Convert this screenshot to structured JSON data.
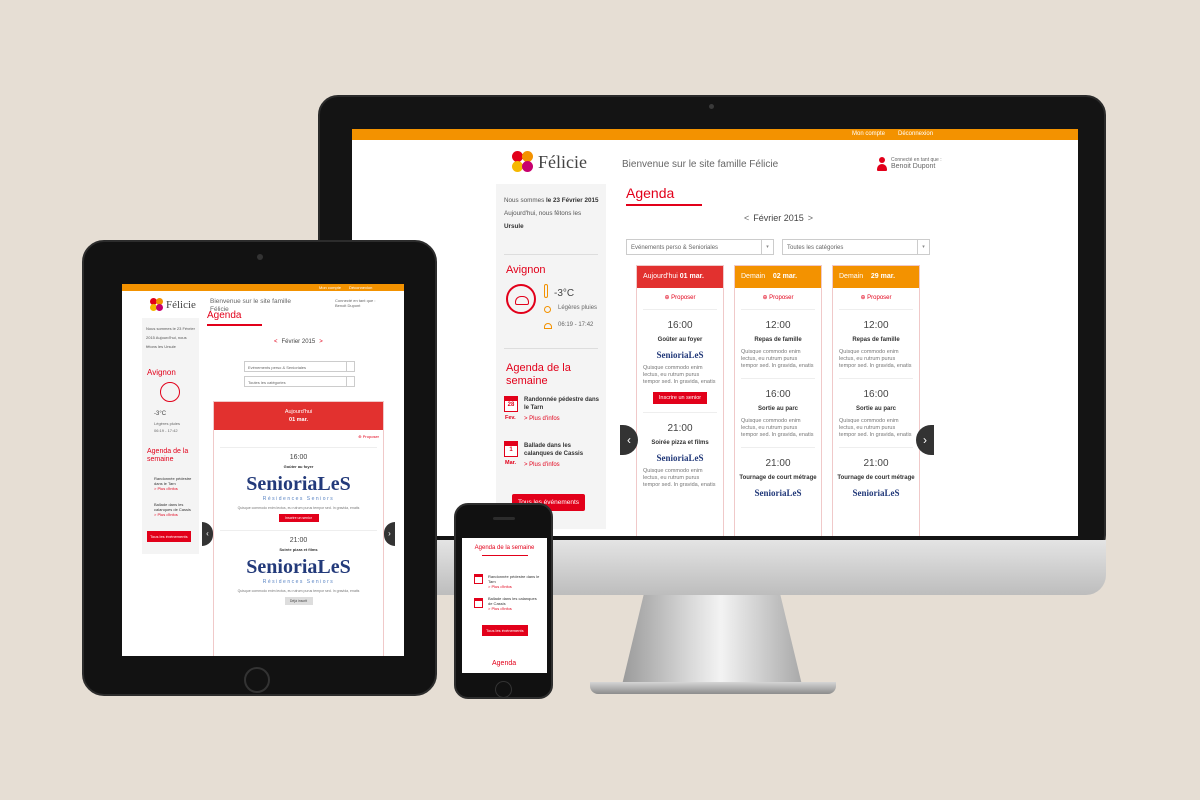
{
  "desktop": {
    "topbar": {
      "account": "Mon compte",
      "logout": "Déconnexion"
    },
    "logo": "Félicie",
    "welcome": "Bienvenue sur le site famille Félicie",
    "user": {
      "connected_as": "Connecté en tant que :",
      "name": "Benoit Dupont"
    },
    "sidebar": {
      "date_prefix": "Nous sommes",
      "date": "le 23 Février 2015",
      "feast_prefix": "Aujourd'hui, nous fêtons les",
      "feast_name": "Ursule",
      "city": "Avignon",
      "temperature": "-3°C",
      "weather": "Légères pluies",
      "sun_times": "06:19 - 17:42",
      "week_title": "Agenda de la semaine",
      "events": [
        {
          "day": "28",
          "month": "Fev.",
          "title": "Randonnée pédestre dans le Tarn",
          "link": "> Plus d'infos"
        },
        {
          "day": "1",
          "month": "Mar.",
          "title": "Ballade dans les calanques de Cassis",
          "link": "> Plus d'infos"
        }
      ],
      "all_events": "Tous les événements"
    },
    "agenda": {
      "title": "Agenda",
      "month": "Février 2015",
      "prev": "<",
      "next": ">",
      "filter1": "Evénements perso & Senioriales",
      "filter2": "Toutes les catégories",
      "propose": "Proposer",
      "columns": [
        {
          "head_a": "Aujourd'hui",
          "head_b": "01 mar.",
          "color": "#e2312f",
          "items": [
            {
              "time": "16:00",
              "title": "Goûter au foyer",
              "logo": "SenioriaLeS",
              "text": "Quisque commodo enim lectus, eu rutrum purus tempor sed. In gravida, enatis",
              "button": "Inscrire un senior"
            },
            {
              "time": "21:00",
              "title": "Soirée pizza et films",
              "logo": "SenioriaLeS",
              "text": "Quisque commodo enim lectus, eu rutrum purus tempor sed. In gravida, enatis"
            }
          ]
        },
        {
          "head_a": "Demain",
          "head_b": "02 mar.",
          "color": "#f39200",
          "items": [
            {
              "time": "12:00",
              "title": "Repas de famille",
              "text": "Quisque commodo enim lectus, eu rutrum purus tempor sed. In gravida, enatis"
            },
            {
              "time": "16:00",
              "title": "Sortie au parc",
              "text": "Quisque commodo enim lectus, eu rutrum purus tempor sed. In gravida, enatis"
            },
            {
              "time": "21:00",
              "title": "Tournage de court métrage",
              "logo": "SenioriaLeS"
            }
          ]
        },
        {
          "head_a": "Demain",
          "head_b": "29 mar.",
          "color": "#f39200",
          "items": [
            {
              "time": "12:00",
              "title": "Repas de famille",
              "text": "Quisque commodo enim lectus, eu rutrum purus tempor sed. In gravida, enatis"
            },
            {
              "time": "16:00",
              "title": "Sortie au parc",
              "text": "Quisque commodo enim lectus, eu rutrum purus tempor sed. In gravida, enatis"
            },
            {
              "time": "21:00",
              "title": "Tournage de court métrage",
              "logo": "SenioriaLeS"
            }
          ]
        }
      ]
    }
  },
  "tablet": {
    "topbar": {
      "account": "Mon compte",
      "logout": "Déconnexion"
    },
    "logo": "Félicie",
    "welcome": "Bienvenue sur le site famille Félicie",
    "user": "Connecté en tant que : Benoit Dupont",
    "date_text": "Nous sommes le 23 Février 2015 Aujourd'hui, nous fêtons les Ursule",
    "city": "Avignon",
    "temperature": "-3°C",
    "weather": "Légères pluies",
    "sun_times": "06:19 - 17:42",
    "week_title": "Agenda de la semaine",
    "events": [
      {
        "title": "Randonnée pédestre dans le Tarn",
        "link": "> Plus d'infos"
      },
      {
        "title": "Ballade dans les calanques de Cassis",
        "link": "> Plus d'infos"
      }
    ],
    "all_events": "Tous les événements",
    "agenda_title": "Agenda",
    "month": "Février 2015",
    "filter1": "Evénements perso & Senioriales",
    "filter2": "Toutes les catégories",
    "card_head_a": "Aujourd'hui",
    "card_head_b": "01 mar.",
    "propose": "Proposer",
    "item1": {
      "time": "16:00",
      "title": "Goûter au foyer",
      "text": "Quisque commodo enim lectus, eu rutrum purus tempor sed. In gravida, enatis",
      "button": "Inscrire un senior"
    },
    "item2": {
      "time": "21:00",
      "title": "Soirée pizza et films",
      "text": "Quisque commodo enim lectus, eu rutrum purus tempor sed. In gravida, enatis",
      "button": "Déjà inscrit"
    },
    "logo_main": "SenioriaLeS",
    "logo_sub": "Résidences Seniors"
  },
  "phone": {
    "week_title": "Agenda de la semaine",
    "events": [
      {
        "title": "Randonnée pédestre dans le Tarn",
        "link": "> Plus d'infos"
      },
      {
        "title": "Ballade dans les calanques de Cassis",
        "link": "> Plus d'infos"
      }
    ],
    "all_events": "Tous les événements",
    "agenda_title": "Agenda"
  }
}
